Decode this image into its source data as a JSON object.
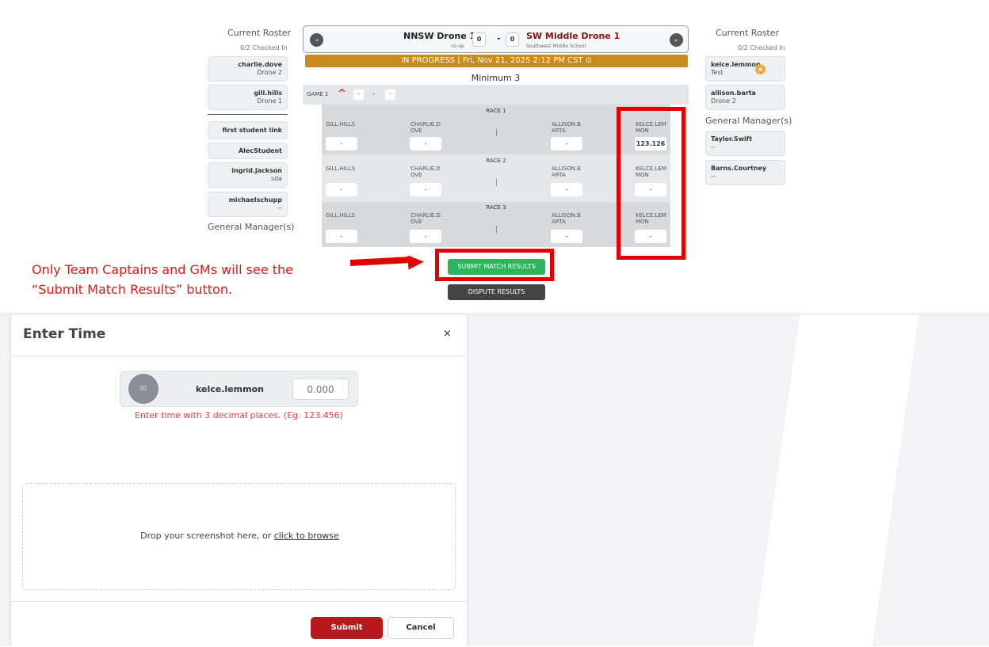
{
  "left_roster": {
    "title": "Current Roster",
    "checked_in": "0/2 Checked In",
    "players": [
      {
        "name": "charlie.dove",
        "sub": "Drone 2"
      },
      {
        "name": "gill.hills",
        "sub": "Drone 1"
      }
    ],
    "others": [
      {
        "name": "first student link",
        "sub": ""
      },
      {
        "name": "AlecStudent",
        "sub": ""
      },
      {
        "name": "ingrid.jackson",
        "sub": "sda"
      },
      {
        "name": "michaelschupp",
        "sub": "--"
      }
    ],
    "gm_title": "General Manager(s)"
  },
  "right_roster": {
    "title": "Current Roster",
    "checked_in": "0/2 Checked In",
    "players": [
      {
        "name": "kelce.lemmon",
        "sub": "Test"
      },
      {
        "name": "allison.barta",
        "sub": "Drone 2"
      }
    ],
    "gm_title": "General Manager(s)",
    "gms": [
      {
        "name": "Taylor.Swift",
        "sub": "--"
      },
      {
        "name": "Barns.Courtney",
        "sub": "--"
      }
    ]
  },
  "match": {
    "home_team": "NNSW Drone 1",
    "home_sub": "co-op",
    "home_score": "0",
    "dash": "-",
    "away_score": "0",
    "away_team": "SW Middle Drone 1",
    "away_sub": "Southwest Middle School",
    "status": "IN PROGRESS | Fri, Nov 21, 2025 2:12 PM CST ⊙",
    "minimum": "Minimum 3",
    "game_label": "GAME 1",
    "game_score_left": "-",
    "game_score_mid": "-",
    "game_score_right": "-"
  },
  "races": [
    {
      "title": "RACE 1",
      "players": [
        "GILL.HILLS",
        "CHARLIE.D\nOVE",
        "ALLISON.B\nARTA",
        "KELCE.LEM\nMON"
      ],
      "times": [
        "-",
        "-",
        "-",
        "123.126"
      ]
    },
    {
      "title": "RACE 2",
      "players": [
        "GILL.HILLS",
        "CHARLIE.D\nOVE",
        "ALLISON.B\nARTA",
        "KELCE.LEM\nMON"
      ],
      "times": [
        "-",
        "-",
        "-",
        "-"
      ]
    },
    {
      "title": "RACE 3",
      "players": [
        "GILL.HILLS",
        "CHARLIE.D\nOVE",
        "ALLISON.B\nARTA",
        "KELCE.LEM\nMON"
      ],
      "times": [
        "-",
        "-",
        "-",
        "-"
      ]
    }
  ],
  "race_separator": "|",
  "buttons": {
    "submit_results": "SUBMIT MATCH RESULTS",
    "dispute_results": "DISPUTE RESULTS"
  },
  "annotation": {
    "line1": "Only Team Captains and GMs will see the",
    "line2": "“Submit Match Results” button."
  },
  "modal": {
    "title": "Enter Time",
    "close": "×",
    "player_name": "kelce.lemmon",
    "time_placeholder": "0.000",
    "hint": "Enter time with 3 decimal places. (Eg. 123.456)",
    "drop_text": "Drop your screenshot here, or ",
    "drop_link": "click to browse",
    "submit": "Submit",
    "cancel": "Cancel"
  },
  "colors": {
    "status_bar": "#c98b21",
    "submit_green": "#2db55d",
    "highlight_red": "#e30000",
    "modal_submit": "#b5191e",
    "away_team": "#8b1010"
  }
}
